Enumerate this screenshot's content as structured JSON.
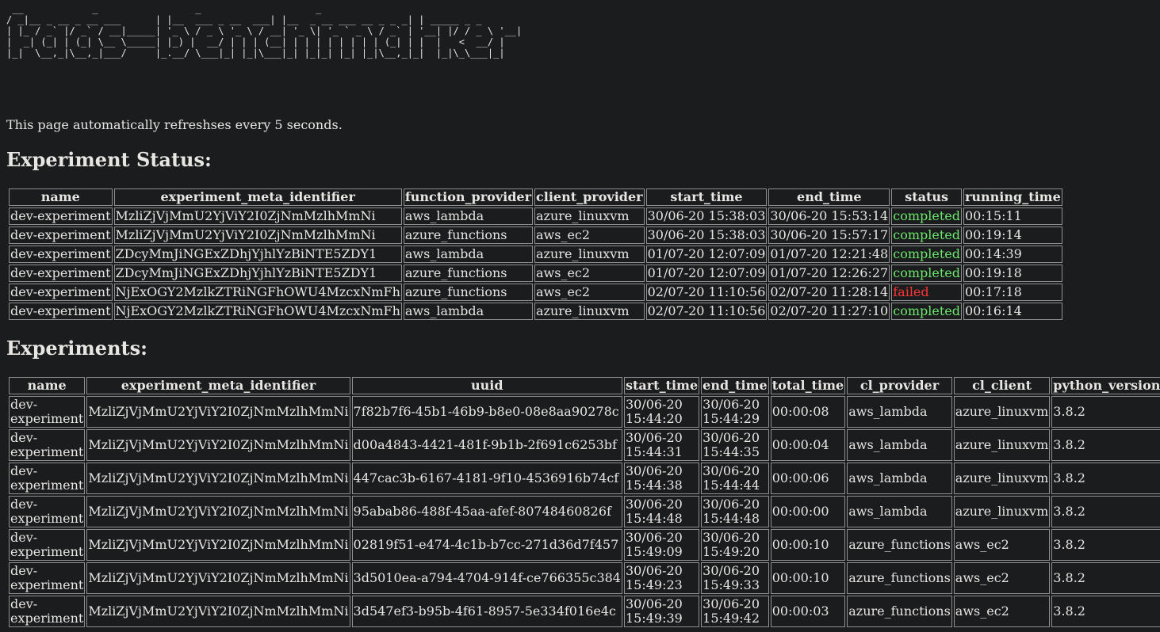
{
  "banner": " __            _                 _                    _\n/ _|__ _ __ _ __ ___      | |__  ___ _ __  ___| |__  _ __ ___ __ _ _ _| | _____ _ _\n| |_ / _` |/ _` / __|_____| '_ \\ / _ \\ '_ \\ / __| '_ \\| '_ ` _ \\ / _` | '__| |/ / _ \\ '__|\n|  _| (_| | (_| \\__ \\_____| |_) |  __/ | | | (__| | | | | | | | | (_| | |  |   <  __/ |\n|_|  \\__,_|\\__,_|___/     |_.__/ \\___|_| |_|\\___|_| |_|_| |_| |_|\\__,_|_|  |_|\\_\\___|_|",
  "refresh_text": "This page automatically refreshses every 5 seconds.",
  "status_heading": "Experiment Status:",
  "status_table": {
    "headers": [
      "name",
      "experiment_meta_identifier",
      "function_provider",
      "client_provider",
      "start_time",
      "end_time",
      "status",
      "running_time"
    ],
    "rows": [
      [
        "dev-experiment",
        "MzliZjVjMmU2YjViY2I0ZjNmMzlhMmNi",
        "aws_lambda",
        "azure_linuxvm",
        "30/06-20 15:38:03",
        "30/06-20 15:53:14",
        "completed",
        "00:15:11"
      ],
      [
        "dev-experiment",
        "MzliZjVjMmU2YjViY2I0ZjNmMzlhMmNi",
        "azure_functions",
        "aws_ec2",
        "30/06-20 15:38:03",
        "30/06-20 15:57:17",
        "completed",
        "00:19:14"
      ],
      [
        "dev-experiment",
        "ZDcyMmJiNGExZDhjYjhlYzBiNTE5ZDY1",
        "aws_lambda",
        "azure_linuxvm",
        "01/07-20 12:07:09",
        "01/07-20 12:21:48",
        "completed",
        "00:14:39"
      ],
      [
        "dev-experiment",
        "ZDcyMmJiNGExZDhjYjhlYzBiNTE5ZDY1",
        "azure_functions",
        "aws_ec2",
        "01/07-20 12:07:09",
        "01/07-20 12:26:27",
        "completed",
        "00:19:18"
      ],
      [
        "dev-experiment",
        "NjExOGY2MzlkZTRiNGFhOWU4MzcxNmFh",
        "azure_functions",
        "aws_ec2",
        "02/07-20 11:10:56",
        "02/07-20 11:28:14",
        "failed",
        "00:17:18"
      ],
      [
        "dev-experiment",
        "NjExOGY2MzlkZTRiNGFhOWU4MzcxNmFh",
        "aws_lambda",
        "azure_linuxvm",
        "02/07-20 11:10:56",
        "02/07-20 11:27:10",
        "completed",
        "00:16:14"
      ]
    ]
  },
  "experiments_heading": "Experiments:",
  "experiments_table": {
    "headers": [
      "name",
      "experiment_meta_identifier",
      "uuid",
      "start_time",
      "end_time",
      "total_time",
      "cl_provider",
      "cl_client",
      "python_version"
    ],
    "rows": [
      [
        "dev-experiment",
        "MzliZjVjMmU2YjViY2I0ZjNmMzlhMmNi",
        "7f82b7f6-45b1-46b9-b8e0-08e8aa90278c",
        "30/06-20 15:44:20",
        "30/06-20 15:44:29",
        "00:00:08",
        "aws_lambda",
        "azure_linuxvm",
        "3.8.2"
      ],
      [
        "dev-experiment",
        "MzliZjVjMmU2YjViY2I0ZjNmMzlhMmNi",
        "d00a4843-4421-481f-9b1b-2f691c6253bf",
        "30/06-20 15:44:31",
        "30/06-20 15:44:35",
        "00:00:04",
        "aws_lambda",
        "azure_linuxvm",
        "3.8.2"
      ],
      [
        "dev-experiment",
        "MzliZjVjMmU2YjViY2I0ZjNmMzlhMmNi",
        "447cac3b-6167-4181-9f10-4536916b74cf",
        "30/06-20 15:44:38",
        "30/06-20 15:44:44",
        "00:00:06",
        "aws_lambda",
        "azure_linuxvm",
        "3.8.2"
      ],
      [
        "dev-experiment",
        "MzliZjVjMmU2YjViY2I0ZjNmMzlhMmNi",
        "95abab86-488f-45aa-afef-80748460826f",
        "30/06-20 15:44:48",
        "30/06-20 15:44:48",
        "00:00:00",
        "aws_lambda",
        "azure_linuxvm",
        "3.8.2"
      ],
      [
        "dev-experiment",
        "MzliZjVjMmU2YjViY2I0ZjNmMzlhMmNi",
        "02819f51-e474-4c1b-b7cc-271d36d7f457",
        "30/06-20 15:49:09",
        "30/06-20 15:49:20",
        "00:00:10",
        "azure_functions",
        "aws_ec2",
        "3.8.2"
      ],
      [
        "dev-experiment",
        "MzliZjVjMmU2YjViY2I0ZjNmMzlhMmNi",
        "3d5010ea-a794-4704-914f-ce766355c384",
        "30/06-20 15:49:23",
        "30/06-20 15:49:33",
        "00:00:10",
        "azure_functions",
        "aws_ec2",
        "3.8.2"
      ],
      [
        "dev-experiment",
        "MzliZjVjMmU2YjViY2I0ZjNmMzlhMmNi",
        "3d547ef3-b95b-4f61-8957-5e334f016e4c",
        "30/06-20 15:49:39",
        "30/06-20 15:49:42",
        "00:00:03",
        "azure_functions",
        "aws_ec2",
        "3.8.2"
      ]
    ]
  },
  "colors": {
    "background": "#1b1c1e",
    "text": "#e8e6e3",
    "completed": "#6de86d",
    "failed": "#ff3434",
    "border": "#8f8f8f"
  }
}
